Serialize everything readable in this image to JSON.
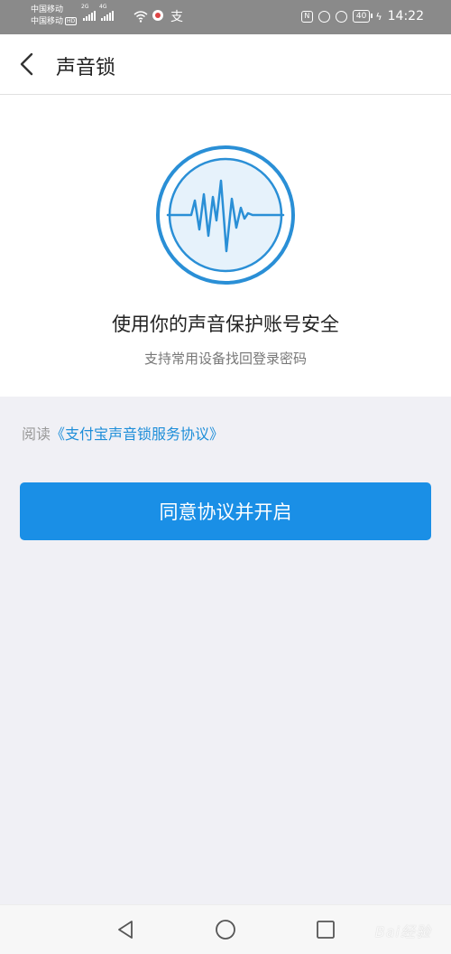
{
  "status_bar": {
    "carrier_1": "中国移动",
    "carrier_2": "中国移动",
    "hd_label": "HD",
    "signal_1_tag": "2G",
    "signal_2_tag": "4G",
    "battery": "40",
    "time": "14:22"
  },
  "header": {
    "title": "声音锁",
    "back_icon": "chevron-left-icon"
  },
  "content": {
    "main_text": "使用你的声音保护账号安全",
    "sub_text": "支持常用设备找回登录密码",
    "graphic_icon": "voice-waveform-icon"
  },
  "agreement": {
    "prefix": "阅读",
    "link": "《支付宝声音锁服务协议》"
  },
  "primary_button": {
    "label": "同意协议并开启"
  },
  "nav_bar": {
    "back": "triangle-back-icon",
    "home": "circle-home-icon",
    "recents": "square-recents-icon"
  },
  "watermark": "Bai经验",
  "colors": {
    "accent": "#1a8fe6",
    "link": "#1e8ed9",
    "background": "#f0f0f5"
  }
}
